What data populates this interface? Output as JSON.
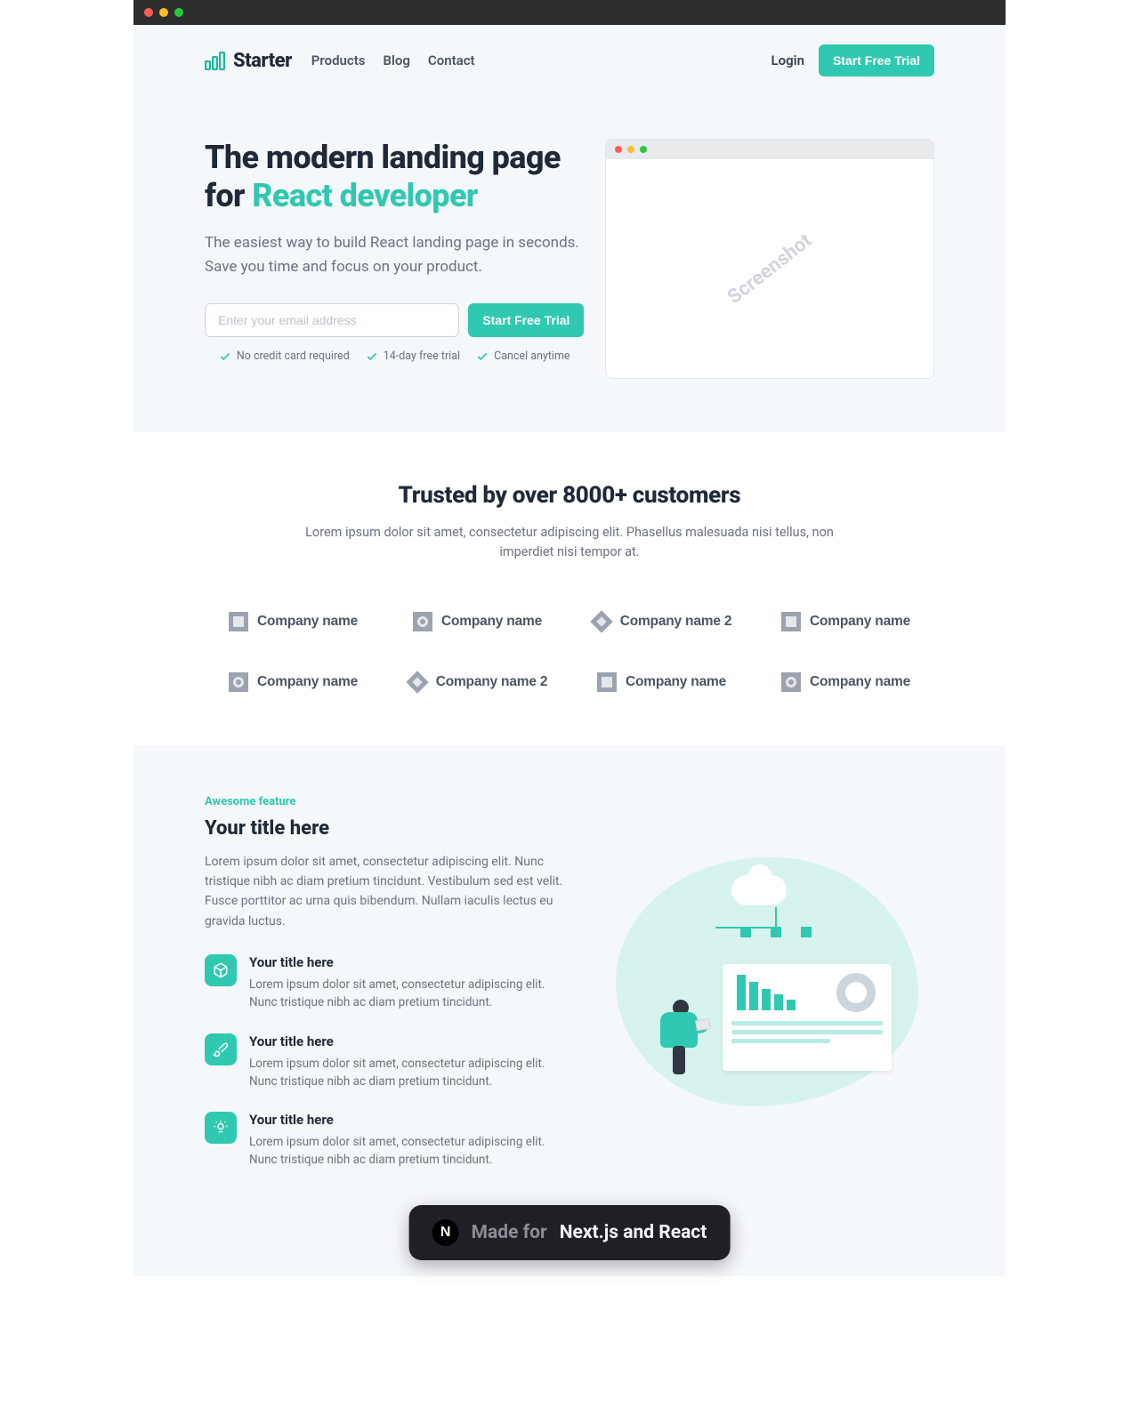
{
  "brand": {
    "name": "Starter"
  },
  "nav": {
    "links": [
      "Products",
      "Blog",
      "Contact"
    ],
    "login": "Login",
    "cta": "Start Free Trial"
  },
  "hero": {
    "title_line1": "The modern landing page",
    "title_line2_prefix": "for ",
    "title_line2_accent": "React developer",
    "subtitle": "The easiest way to build React landing page in seconds. Save you time and focus on your product.",
    "email_placeholder": "Enter your email address",
    "cta": "Start Free Trial",
    "perks": [
      "No credit card required",
      "14-day free trial",
      "Cancel anytime"
    ],
    "mock_label": "Screenshot"
  },
  "customers": {
    "title": "Trusted by over 8000+ customers",
    "subtitle": "Lorem ipsum dolor sit amet, consectetur adipiscing elit. Phasellus malesuada nisi tellus, non imperdiet nisi tempor at.",
    "logos": [
      {
        "glyph": "square",
        "name": "Company name"
      },
      {
        "glyph": "circle",
        "name": "Company name"
      },
      {
        "glyph": "diamond",
        "name": "Company name 2"
      },
      {
        "glyph": "square",
        "name": "Company name"
      },
      {
        "glyph": "circle",
        "name": "Company name"
      },
      {
        "glyph": "diamond",
        "name": "Company name 2"
      },
      {
        "glyph": "square",
        "name": "Company name"
      },
      {
        "glyph": "circle",
        "name": "Company name"
      }
    ]
  },
  "features": {
    "eyebrow": "Awesome feature",
    "title": "Your title here",
    "description": "Lorem ipsum dolor sit amet, consectetur adipiscing elit. Nunc tristique nibh ac diam pretium tincidunt. Vestibulum sed est velit. Fusce porttitor ac urna quis bibendum. Nullam iaculis lectus eu gravida luctus.",
    "items": [
      {
        "icon": "cube",
        "title": "Your title here",
        "desc": "Lorem ipsum dolor sit amet, consectetur adipiscing elit. Nunc tristique nibh ac diam pretium tincidunt."
      },
      {
        "icon": "brush",
        "title": "Your title here",
        "desc": "Lorem ipsum dolor sit amet, consectetur adipiscing elit. Nunc tristique nibh ac diam pretium tincidunt."
      },
      {
        "icon": "bulb",
        "title": "Your title here",
        "desc": "Lorem ipsum dolor sit amet, consectetur adipiscing elit. Nunc tristique nibh ac diam pretium tincidunt."
      }
    ]
  },
  "toast": {
    "made_for": "Made for",
    "target": "Next.js and React"
  }
}
